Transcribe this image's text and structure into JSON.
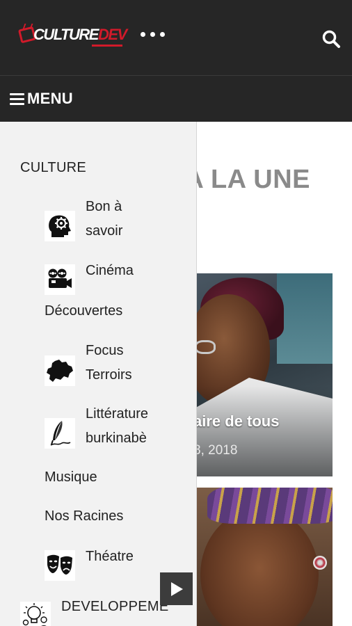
{
  "header": {
    "logo_text_left": "CULTURE",
    "logo_text_right": "DEV",
    "menu_label": "MENU"
  },
  "content": {
    "section_heading": "A LA UNE",
    "card1_title": "aire de tous",
    "card1_date": "8, 2018"
  },
  "drawer": {
    "category": "CULTURE",
    "items": [
      {
        "label_line1": "Bon à",
        "label_line2": "savoir",
        "icon": "head-gear-icon"
      },
      {
        "label_line1": "Cinéma",
        "label_line2": "Découvertes",
        "icon": "film-camera-icon"
      },
      {
        "label_line1": "Focus",
        "label_line2": "Terroirs",
        "icon": "burkina-map-icon"
      },
      {
        "label_line1": "Littérature",
        "label_line2": "burkinabè",
        "icon": "quill-pen-icon"
      },
      {
        "label_line1": "Musique",
        "label_line2": "",
        "icon": ""
      },
      {
        "label_line1": "Nos Racines",
        "label_line2": "",
        "icon": ""
      },
      {
        "label_line1": "Théatre",
        "label_line2": "",
        "icon": "theatre-masks-icon"
      }
    ],
    "next_category": "DEVELOPPEME"
  },
  "colors": {
    "header_bg": "#262626",
    "brand_red": "#d11a2a",
    "drawer_bg": "#f2f2f2",
    "heading_gray": "#8a8a8a"
  }
}
